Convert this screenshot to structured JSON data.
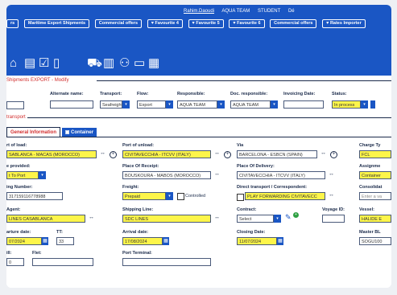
{
  "header": {
    "status_items": [
      "Rahim.Daoudi",
      "AQUA TEAM",
      "STUDENT",
      "Dé"
    ],
    "tabs": [
      "rs",
      "Maritime Export Shipments",
      "Commercial offers",
      "Favourite 4",
      "Favourite 5",
      "Favourite 6",
      "Commercial offers",
      "Rates Importer"
    ]
  },
  "toolbar": {
    "icons": [
      "bank-icon",
      "document-icon",
      "check-document-icon",
      "file-icon",
      "vehicle-icon",
      "barcode-icon",
      "users-icon",
      "page-icon",
      "calculator-icon"
    ]
  },
  "breadcrumb": "Shipments EXPORT - Modify",
  "form": {
    "alternate_name": {
      "label": "Alternate name:",
      "value": ""
    },
    "transport": {
      "label": "Transport:",
      "value": "Seafreight"
    },
    "flow": {
      "label": "Flow:",
      "value": "Export"
    },
    "responsible": {
      "label": "Responsible:",
      "value": "AQUA TEAM"
    },
    "doc_responsible": {
      "label": "Doc. responsible:",
      "value": "AQUA TEAM"
    },
    "invoicing_date": {
      "label": "Invoicing Date:",
      "value": ""
    },
    "status": {
      "label": "Status:",
      "value": "In process"
    }
  },
  "section_transport": "transport",
  "tabs": {
    "general": "General Information",
    "container": "Container"
  },
  "transport": {
    "port_of_load": {
      "label": "rt of load:",
      "value": "SABLANCA - MACAS (MOROCCO)"
    },
    "port_of_unload": {
      "label": "Port of unload:",
      "value": "CIVITAVECCHIA - ITCVV (ITALY)"
    },
    "via": {
      "label": "Via",
      "value": "BARCELONA - ESBCN (SPAIN)"
    },
    "charge_type": {
      "label": "Charge Ty",
      "value": "FCL"
    },
    "service_provided": {
      "label": "e provided:",
      "value": "t To Port"
    },
    "place_of_receipt": {
      "label": "Place Of Receipt:",
      "value": "BOUSKOURA - MABOS (MOROCCO)"
    },
    "place_of_delivery": {
      "label": "Place Of Delivery:",
      "value": "CIVITAVECCHIA - ITCVV (ITALY)"
    },
    "assignment": {
      "label": "Assignme",
      "value": "Container"
    },
    "booking_number": {
      "label": "ing Number:",
      "value": "317159116778988"
    },
    "freight": {
      "label": "Freight:",
      "value": "Prepaid"
    },
    "controlled": {
      "label": "Controlled"
    },
    "direct_transport": {
      "label": "Direct transport / Correspondent:",
      "value": "PLAY FORWARDING CIVITAVECC"
    },
    "consolidation": {
      "label": "Consolidat",
      "value": "Enter a va"
    },
    "agent": {
      "label": "Agent:",
      "value": "LINES CASABLANCA"
    },
    "shipping_line": {
      "label": "Shipping Line:",
      "value": "SDC LINES"
    },
    "contract": {
      "label": "Contract:",
      "value": "Select"
    },
    "voyage_id": {
      "label": "Voyage ID:",
      "value": ""
    },
    "vessel": {
      "label": "Vessel:",
      "value": "HALIDE E"
    },
    "departure_date": {
      "label": "arture date:",
      "value": "07/2024"
    },
    "tt": {
      "label": "TT:",
      "value": "33"
    },
    "arrival_date": {
      "label": "Arrival date:",
      "value": "17/08/2024"
    },
    "closing_date": {
      "label": "Closing Date:",
      "value": "11/07/2024"
    },
    "master_bl": {
      "label": "Master BL",
      "value": "SOGU100"
    },
    "ill": {
      "label": "ill:",
      "value": "0"
    },
    "flet": {
      "label": "Flet:",
      "value": ""
    },
    "port_terminal": {
      "label": "Port Terminal:",
      "value": ""
    }
  }
}
